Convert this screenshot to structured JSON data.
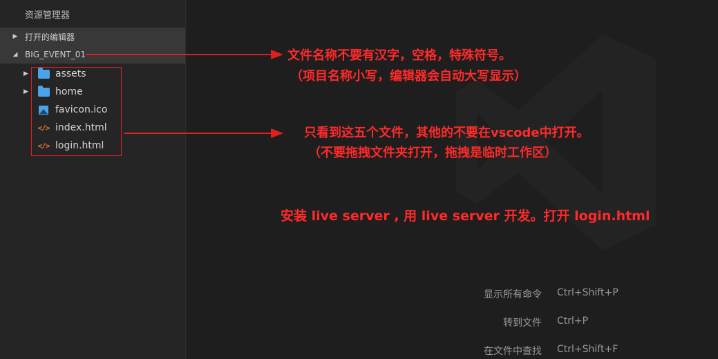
{
  "sidebar": {
    "title": "资源管理器",
    "open_editors_label": "打开的编辑器",
    "project_label": "BIG_EVENT_01",
    "items": [
      {
        "label": "assets",
        "type": "folder"
      },
      {
        "label": "home",
        "type": "folder"
      },
      {
        "label": "favicon.ico",
        "type": "image"
      },
      {
        "label": "index.html",
        "type": "html"
      },
      {
        "label": "login.html",
        "type": "html"
      }
    ]
  },
  "annotations": {
    "note1": "文件名称不要有汉字，空格，特殊符号。",
    "note2": "（项目名称小写，编辑器会自动大写显示）",
    "note3": "只看到这五个文件，其他的不要在vscode中打开。",
    "note4": "（不要拖拽文件夹打开，拖拽是临时工作区）",
    "note5": "安装  live  server , 用 live  server 开发。打开 login.html",
    "color": "#ff2a2a"
  },
  "shortcuts": [
    {
      "label": "显示所有命令",
      "keys": "Ctrl+Shift+P"
    },
    {
      "label": "转到文件",
      "keys": "Ctrl+P"
    },
    {
      "label": "在文件中查找",
      "keys": "Ctrl+Shift+F"
    }
  ],
  "icons": {
    "folder": "folder-icon",
    "image": "image-file-icon",
    "html": "code-file-icon",
    "chevron_right": "chevron-right-icon",
    "chevron_down": "chevron-down-icon"
  }
}
